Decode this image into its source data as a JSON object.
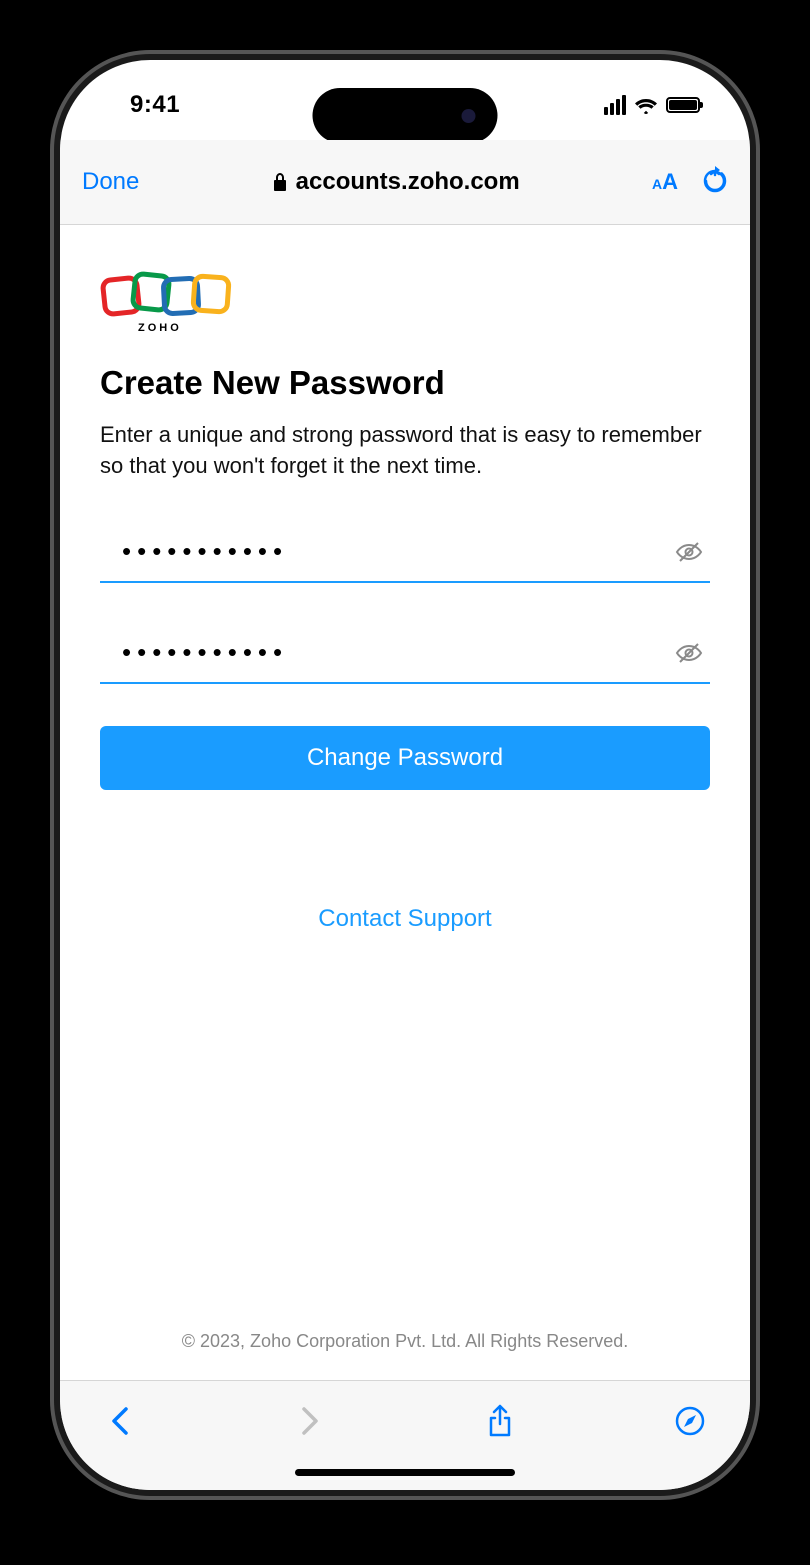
{
  "status": {
    "time": "9:41"
  },
  "nav": {
    "done": "Done",
    "url": "accounts.zoho.com"
  },
  "logo": {
    "text": "ZOHO"
  },
  "page": {
    "heading": "Create New Password",
    "subheading": "Enter a unique and strong password that is easy to remember so that you won't forget it the next time."
  },
  "form": {
    "password1": "●●●●●●●●●●●",
    "password2": "●●●●●●●●●●●",
    "submit": "Change Password"
  },
  "links": {
    "support": "Contact Support"
  },
  "footer": {
    "copyright": "© 2023, Zoho Corporation Pvt. Ltd. All Rights Reserved."
  }
}
